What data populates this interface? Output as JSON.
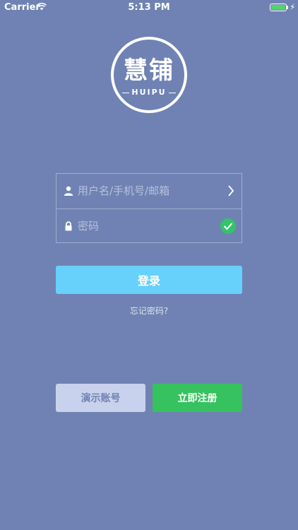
{
  "status_bar": {
    "carrier": "Carrier",
    "time": "5:13 PM",
    "battery_color": "#4cd964",
    "icons": [
      "wifi-icon",
      "battery-icon",
      "charging-bolt-icon"
    ]
  },
  "logo": {
    "main_text": "慧铺",
    "sub_text": "HUIPU"
  },
  "form": {
    "username": {
      "value": "",
      "placeholder": "用户名/手机号/邮箱",
      "icon": "user-icon",
      "trailing_icon": "chevron-right-icon"
    },
    "password": {
      "value": "",
      "placeholder": "密码",
      "icon": "lock-icon",
      "trailing_icon": "check-circle-icon"
    }
  },
  "actions": {
    "login_label": "登录",
    "forgot_label": "忘记密码?",
    "demo_label": "演示账号",
    "register_label": "立即注册"
  },
  "colors": {
    "background": "#6f82b3",
    "login_button": "#67d0fb",
    "register_button": "#36c25e",
    "demo_button": "#c9d2ec",
    "check_badge": "#35c36a"
  }
}
